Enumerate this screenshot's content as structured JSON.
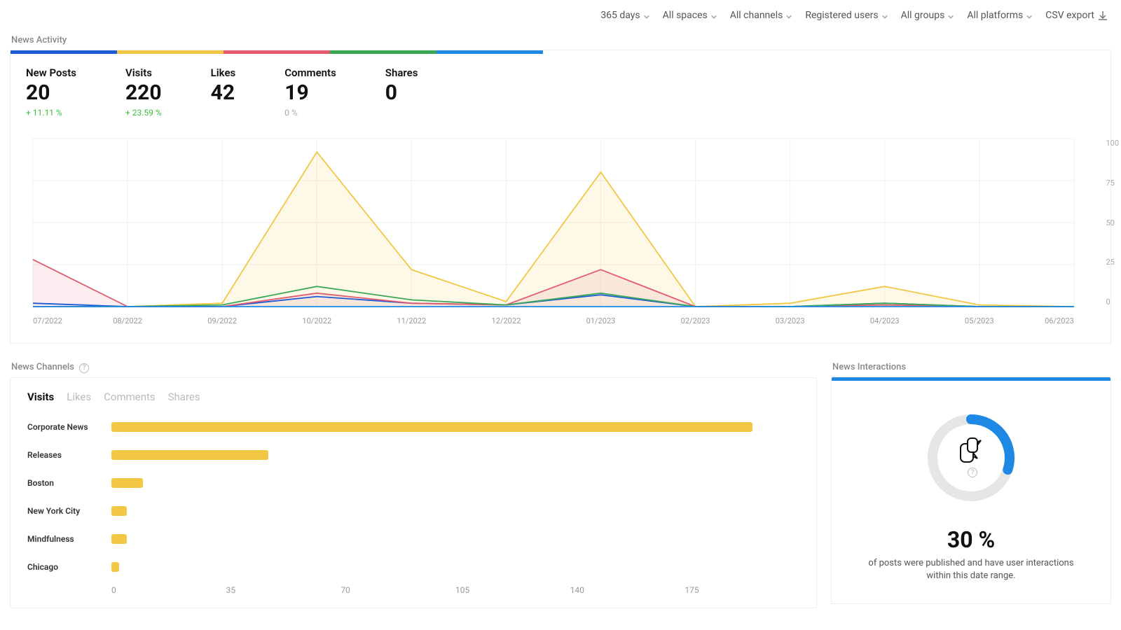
{
  "colors": {
    "new_posts": "#1e5bd6",
    "visits": "#f2c744",
    "likes": "#e45a6e",
    "comments": "#3aa757",
    "shares": "#1e88e5",
    "grid": "#f0f0f0",
    "axis_text": "#999"
  },
  "filters": {
    "date_range": "365 days",
    "spaces": "All spaces",
    "channels": "All channels",
    "users": "Registered users",
    "groups": "All groups",
    "platforms": "All platforms",
    "export_label": "CSV export"
  },
  "activity": {
    "section_title": "News Activity",
    "kpis": [
      {
        "key": "new_posts",
        "label": "New Posts",
        "value": "20",
        "delta": "+ 11.11 %",
        "delta_class": "green"
      },
      {
        "key": "visits",
        "label": "Visits",
        "value": "220",
        "delta": "+ 23.59 %",
        "delta_class": "green"
      },
      {
        "key": "likes",
        "label": "Likes",
        "value": "42",
        "delta": "",
        "delta_class": "grey"
      },
      {
        "key": "comments",
        "label": "Comments",
        "value": "19",
        "delta": "0 %",
        "delta_class": "grey"
      },
      {
        "key": "shares",
        "label": "Shares",
        "value": "0",
        "delta": "",
        "delta_class": "grey"
      }
    ]
  },
  "chart_data": [
    {
      "type": "line",
      "title": "News Activity",
      "xlabel": "",
      "ylabel": "",
      "ylim": [
        0,
        100
      ],
      "y_ticks": [
        100,
        75,
        50,
        25,
        0
      ],
      "categories": [
        "07/2022",
        "08/2022",
        "09/2022",
        "10/2022",
        "11/2022",
        "12/2022",
        "01/2023",
        "02/2023",
        "03/2023",
        "04/2023",
        "05/2023",
        "06/2023"
      ],
      "series": [
        {
          "name": "New Posts",
          "color": "#1e5bd6",
          "values": [
            2,
            0,
            0,
            6,
            2,
            1,
            7,
            0,
            0,
            2,
            0,
            0
          ]
        },
        {
          "name": "Visits",
          "color": "#f2c744",
          "values": [
            0,
            0,
            2,
            92,
            22,
            3,
            80,
            0,
            2,
            12,
            1,
            0
          ]
        },
        {
          "name": "Likes",
          "color": "#e45a6e",
          "values": [
            28,
            0,
            0,
            8,
            2,
            1,
            22,
            0,
            0,
            1,
            0,
            0
          ]
        },
        {
          "name": "Comments",
          "color": "#3aa757",
          "values": [
            0,
            0,
            1,
            12,
            4,
            1,
            8,
            0,
            0,
            2,
            0,
            0
          ]
        },
        {
          "name": "Shares",
          "color": "#1e88e5",
          "values": [
            0,
            0,
            0,
            0,
            0,
            0,
            0,
            0,
            0,
            0,
            0,
            0
          ]
        }
      ]
    },
    {
      "type": "bar",
      "orientation": "horizontal",
      "title": "News Channels — Visits",
      "xlabel": "",
      "xlim": [
        0,
        175
      ],
      "x_ticks": [
        0,
        35,
        70,
        105,
        140,
        175
      ],
      "categories": [
        "Corporate News",
        "Releases",
        "Boston",
        "New York City",
        "Mindfulness",
        "Chicago"
      ],
      "values": [
        163,
        40,
        8,
        4,
        4,
        2
      ],
      "color": "#f2c744"
    }
  ],
  "channels": {
    "section_title": "News Channels",
    "tabs": [
      "Visits",
      "Likes",
      "Comments",
      "Shares"
    ],
    "active_tab": "Visits"
  },
  "interactions": {
    "section_title": "News Interactions",
    "percent_value": 30,
    "percent_label": "30 %",
    "caption": "of posts were published and have user interactions within this date range."
  }
}
